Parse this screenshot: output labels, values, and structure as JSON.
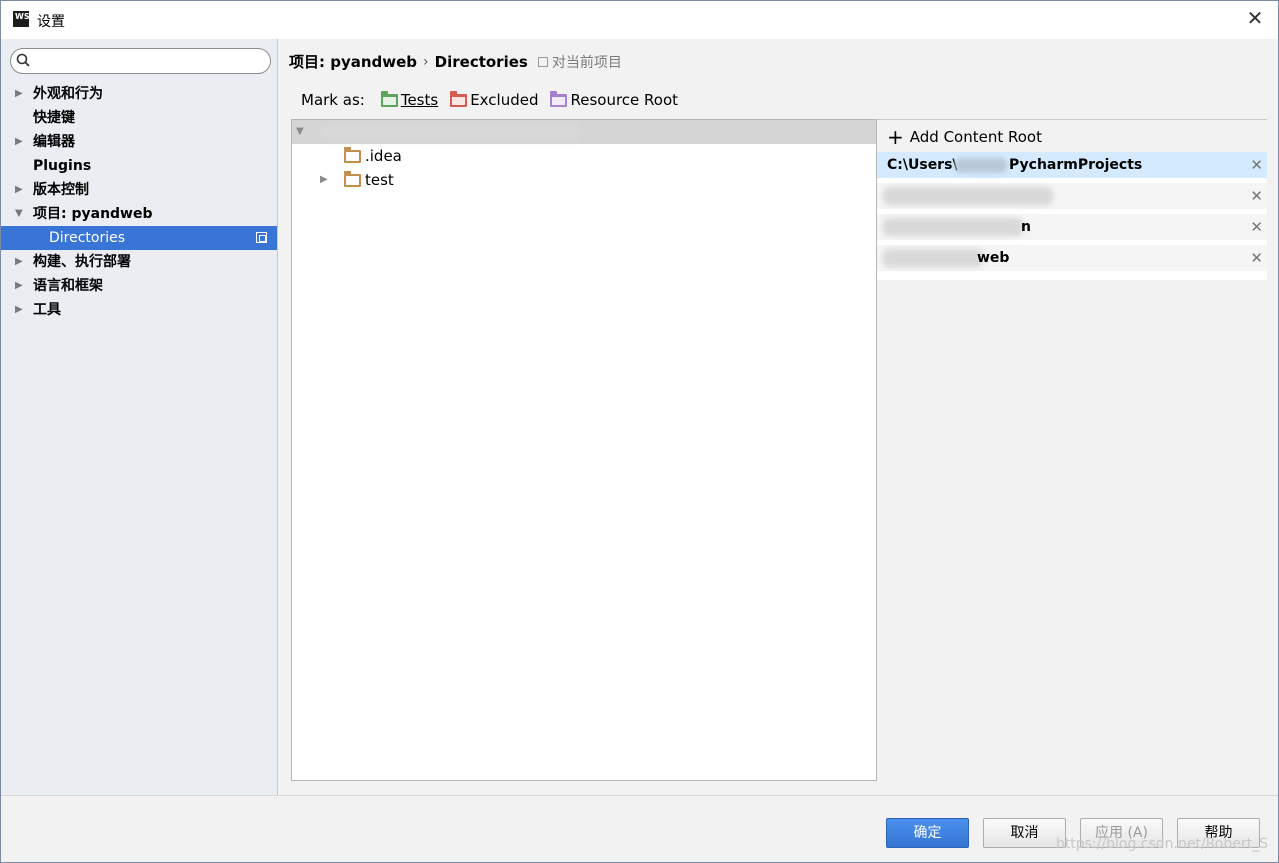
{
  "window": {
    "title": "设置",
    "app_icon_text": "WS"
  },
  "search": {
    "placeholder": "",
    "value": ""
  },
  "sidebar": {
    "items": [
      {
        "label": "外观和行为",
        "has_arrow": true
      },
      {
        "label": "快捷键",
        "has_arrow": false
      },
      {
        "label": "编辑器",
        "has_arrow": true
      },
      {
        "label": "Plugins",
        "has_arrow": false
      },
      {
        "label": "版本控制",
        "has_arrow": true
      },
      {
        "label": "项目: pyandweb",
        "has_arrow": true,
        "expanded": true
      },
      {
        "label": "Directories",
        "sub": true,
        "selected": true
      },
      {
        "label": "构建、执行部署",
        "has_arrow": true
      },
      {
        "label": "语言和框架",
        "has_arrow": true
      },
      {
        "label": "工具",
        "has_arrow": true
      }
    ]
  },
  "breadcrumb": {
    "project": "项目: pyandweb",
    "separator": "›",
    "page": "Directories",
    "scope": "对当前项目"
  },
  "mark_as": {
    "label": "Mark as:",
    "tests": "Tests",
    "excluded": "Excluded",
    "resource_root": "Resource Root"
  },
  "tree": {
    "items": [
      {
        "label": ".idea"
      },
      {
        "label": "test"
      }
    ]
  },
  "content_roots": {
    "add_label": "Add Content Root",
    "items": [
      {
        "label": "C:\\Users\\",
        "suffix": "PycharmProjects",
        "selected": true
      },
      {
        "label": "",
        "suffix": ""
      },
      {
        "label": "",
        "suffix": "n"
      },
      {
        "label": "",
        "suffix": "web"
      }
    ]
  },
  "footer": {
    "ok": "确定",
    "cancel": "取消",
    "apply": "应用 (A)",
    "help": "帮助",
    "watermark": "https://blog.csdn.net/Robert_S"
  },
  "colors": {
    "accent": "#3875d7",
    "primary_button": "#3a7ad9",
    "tests": "#5aa55a",
    "excluded": "#d75a4f",
    "resource": "#a681cf",
    "folder": "#c28f4f"
  }
}
